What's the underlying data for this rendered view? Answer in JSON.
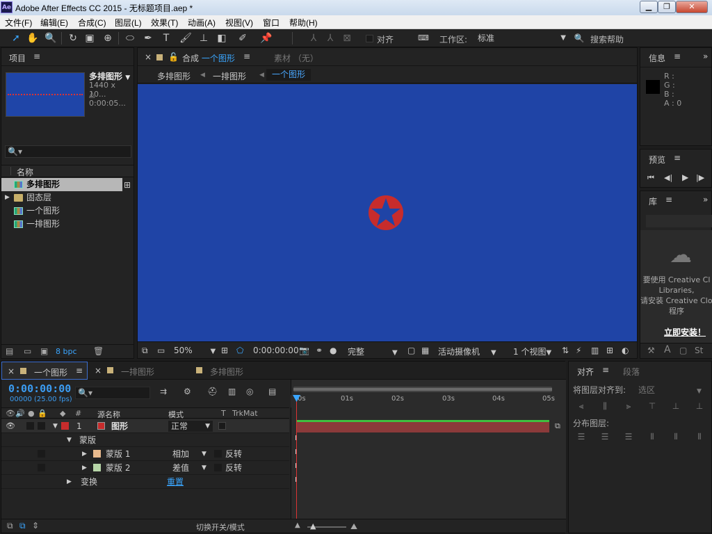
{
  "window": {
    "logo": "Ae",
    "title": "Adobe After Effects CC 2015 - 无标题项目.aep *",
    "minimize": "▁",
    "maximize": "❐",
    "close": "✕"
  },
  "menu": [
    "文件(F)",
    "编辑(E)",
    "合成(C)",
    "图层(L)",
    "效果(T)",
    "动画(A)",
    "视图(V)",
    "窗口",
    "帮助(H)"
  ],
  "toolbar": {
    "align_label": "对齐",
    "workspace_label": "工作区:",
    "workspace_value": "标准",
    "search_help": "搜索帮助"
  },
  "project": {
    "title": "项目",
    "item_name": "多排图形",
    "item_dims": "1440 x 10...",
    "item_duration": "△ 0:00:05...",
    "search_placeholder": "🔍▾",
    "col_name": "名称",
    "items": [
      {
        "name": "多排图形",
        "type": "comp",
        "selected": true
      },
      {
        "name": "固态层",
        "type": "folder",
        "selected": false
      },
      {
        "name": "一个图形",
        "type": "comp",
        "selected": false
      },
      {
        "name": "一排图形",
        "type": "comp",
        "selected": false
      }
    ],
    "bpc": "8 bpc"
  },
  "composition": {
    "tab_prefix": "合成",
    "tab_name": "一个图形",
    "footage_tab": "素材 （无）",
    "breadcrumbs": [
      "多排图形",
      "一排图形",
      "一个图形"
    ],
    "zoom": "50%",
    "timecode": "0:00:00:00",
    "resolution": "完整",
    "camera": "活动摄像机",
    "views": "1 个视图",
    "viewer_color": "#1f44a6",
    "star_color": "#c72c2c"
  },
  "info": {
    "title": "信息",
    "r": "R :",
    "g": "G :",
    "b": "B :",
    "a": "A : 0"
  },
  "preview": {
    "title": "预览"
  },
  "library": {
    "title": "库",
    "msg1": "要使用 Creative Cl",
    "msg2": "Libraries,",
    "msg3": "请安装 Creative Clou",
    "msg4": "程序",
    "install": "立即安装！"
  },
  "timeline": {
    "active_tab": "一个图形",
    "tab2": "一排图形",
    "tab3": "多排图形",
    "timecode": "0:00:00:00",
    "fps": "00000 (25.00 fps)",
    "col_hash": "#",
    "col_source": "源名称",
    "col_mode": "模式",
    "col_t": "T",
    "col_trkmat": "TrkMat",
    "ruler": [
      "0s",
      "01s",
      "02s",
      "03s",
      "04s",
      "05s"
    ],
    "layer": {
      "num": "1",
      "name": "图形",
      "mode": "正常",
      "color": "#c72c2c"
    },
    "mask_group": "蒙版",
    "masks": [
      {
        "name": "蒙版 1",
        "mode": "相加",
        "invert": "反转",
        "color": "#e8b98d"
      },
      {
        "name": "蒙版 2",
        "mode": "差值",
        "invert": "反转",
        "color": "#b7d6a8"
      }
    ],
    "transform": "变换",
    "reset": "重置",
    "footer_toggle": "切换开关/模式"
  },
  "align": {
    "title": "对齐",
    "tab2": "段落",
    "align_to_label": "将图层对齐到:",
    "align_to_value": "选区",
    "distribute_label": "分布图层:"
  }
}
